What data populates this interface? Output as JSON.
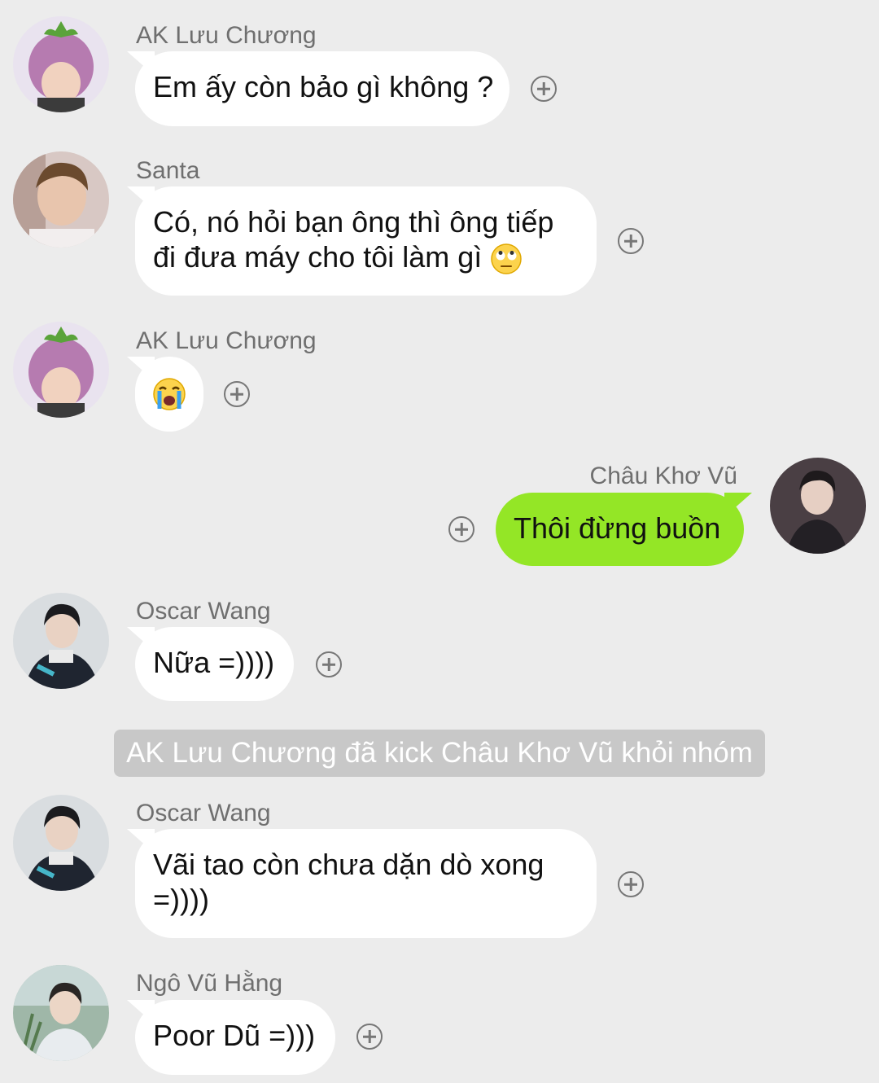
{
  "messages": [
    {
      "sender": "AK Lưu Chương",
      "text": "Em ấy còn bảo gì không ?"
    },
    {
      "sender": "Santa",
      "text_line1": "Có, nó hỏi bạn ông thì ông tiếp",
      "text_line2": "đi đưa máy cho tôi làm gì",
      "emoji": "rolling-eyes-emoji"
    },
    {
      "sender": "AK Lưu Chương",
      "emoji": "loudly-crying-emoji"
    },
    {
      "sender": "Châu Khơ Vũ",
      "text": "Thôi đừng buồn",
      "outgoing": true
    },
    {
      "sender": "Oscar Wang",
      "text": "Nữa =))))"
    },
    {
      "sender": "Oscar Wang",
      "text_line1": "Vãi tao còn chưa dặn dò xong",
      "text_line2": "=))))"
    },
    {
      "sender": "Ngô Vũ Hằng",
      "text": "Poor Dũ =)))"
    }
  ],
  "system_notice": "AK Lưu Chương đã kick Châu Khơ Vũ khỏi nhóm",
  "icons": {
    "reaction": "add-circle-icon"
  },
  "colors": {
    "background": "#ececec",
    "incoming_bubble": "#ffffff",
    "outgoing_bubble": "#94e626",
    "notice": "#c8c8c8",
    "sender_name": "#6f6f6f"
  }
}
